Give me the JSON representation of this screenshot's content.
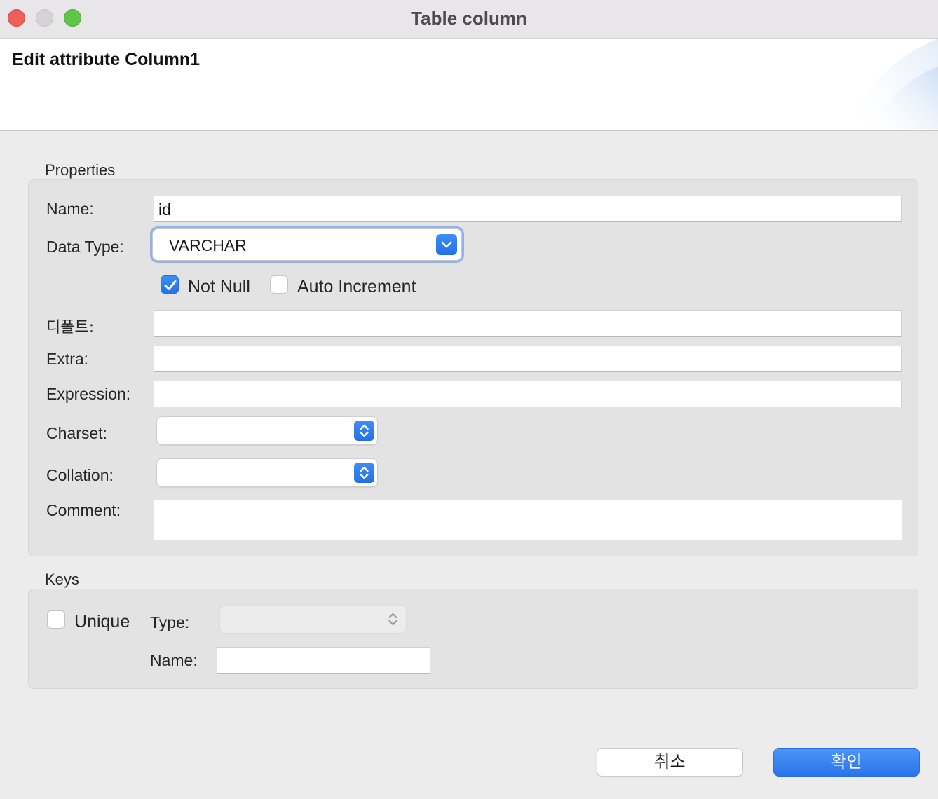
{
  "window": {
    "title": "Table column"
  },
  "banner": {
    "title": "Edit attribute Column1"
  },
  "properties": {
    "group_label": "Properties",
    "name_label": "Name:",
    "name_value": "id",
    "datatype_label": "Data Type:",
    "datatype_value": "VARCHAR",
    "not_null_label": "Not Null",
    "not_null_checked": true,
    "auto_increment_label": "Auto Increment",
    "auto_increment_checked": false,
    "default_label": "디폴트:",
    "default_value": "",
    "extra_label": "Extra:",
    "extra_value": "",
    "expression_label": "Expression:",
    "expression_value": "",
    "charset_label": "Charset:",
    "charset_value": "",
    "collation_label": "Collation:",
    "collation_value": "",
    "comment_label": "Comment:",
    "comment_value": ""
  },
  "keys": {
    "group_label": "Keys",
    "unique_label": "Unique",
    "unique_checked": false,
    "type_label": "Type:",
    "type_value": "",
    "name_label": "Name:",
    "name_value": ""
  },
  "buttons": {
    "cancel": "취소",
    "ok": "확인"
  },
  "colors": {
    "accent": "#2a74ea",
    "close": "#ee5f57",
    "maximize": "#5fc548",
    "focus_ring": "#8fb1ee"
  }
}
